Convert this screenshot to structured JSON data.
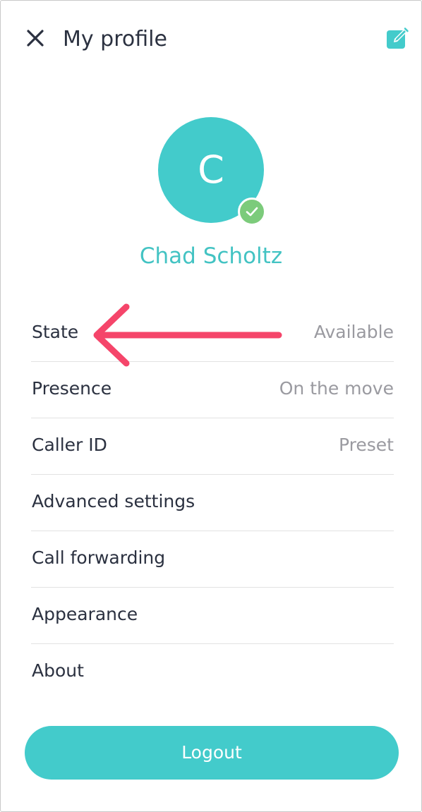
{
  "header": {
    "title": "My profile",
    "close_icon": "close-icon",
    "edit_icon": "edit-icon"
  },
  "profile": {
    "avatar_initial": "C",
    "name": "Chad Scholtz",
    "status": "available-check"
  },
  "menu": [
    {
      "label": "State",
      "value": "Available"
    },
    {
      "label": "Presence",
      "value": "On the move"
    },
    {
      "label": "Caller ID",
      "value": "Preset"
    },
    {
      "label": "Advanced settings",
      "value": ""
    },
    {
      "label": "Call forwarding",
      "value": ""
    },
    {
      "label": "Appearance",
      "value": ""
    },
    {
      "label": "About",
      "value": ""
    }
  ],
  "logout_label": "Logout",
  "annotation": {
    "type": "arrow-pointing-left",
    "target": "State"
  },
  "colors": {
    "accent": "#43cbcb",
    "name_text": "#43c3c3",
    "status_green": "#7ccb7b",
    "arrow": "#f5456a",
    "text": "#2b3140",
    "muted": "#9a9aa0"
  }
}
